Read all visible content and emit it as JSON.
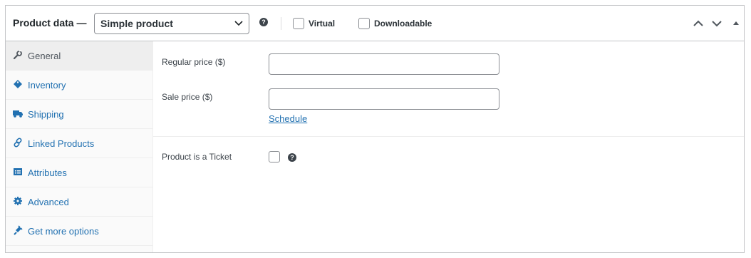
{
  "header": {
    "title": "Product data —",
    "product_type": {
      "selected": "Simple product",
      "icon": "chevron-down-icon"
    },
    "help_icon": "help-icon",
    "virtual_label": "Virtual",
    "downloadable_label": "Downloadable",
    "controls": [
      "move-up-icon",
      "move-down-icon",
      "toggle-panel-icon"
    ]
  },
  "sidebar": {
    "tabs": [
      {
        "label": "General",
        "icon": "wrench-icon",
        "active": true
      },
      {
        "label": "Inventory",
        "icon": "tag-icon"
      },
      {
        "label": "Shipping",
        "icon": "truck-icon"
      },
      {
        "label": "Linked Products",
        "icon": "link-icon"
      },
      {
        "label": "Attributes",
        "icon": "table-icon"
      },
      {
        "label": "Advanced",
        "icon": "gear-icon"
      },
      {
        "label": "Get more options",
        "icon": "plugin-icon"
      }
    ]
  },
  "general": {
    "regular_price_label": "Regular price ($)",
    "regular_price_value": "",
    "sale_price_label": "Sale price ($)",
    "sale_price_value": "",
    "schedule_link": "Schedule",
    "ticket_label": "Product is a Ticket"
  },
  "colors": {
    "link": "#2271b1",
    "border": "#c3c4c7",
    "sidebar_bg": "#fafafa",
    "active_tab_bg": "#eeeeee"
  }
}
